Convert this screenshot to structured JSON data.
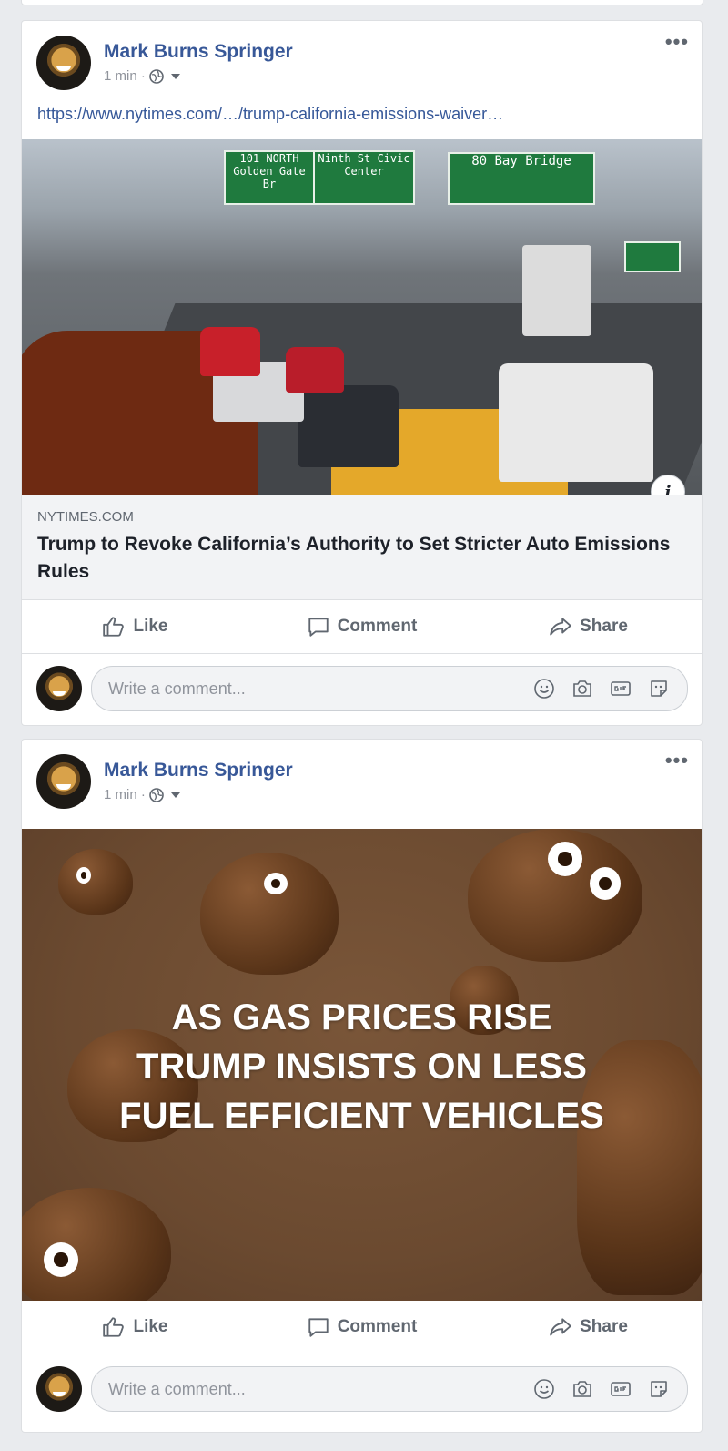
{
  "posts": [
    {
      "author": "Mark Burns Springer",
      "time": "1 min ·",
      "link_url": "https://www.nytimes.com/…/trump-california-emissions-waiver…",
      "link_domain": "NYTIMES.COM",
      "link_title": "Trump to Revoke California’s Authority to Set Stricter Auto Emissions Rules",
      "signs": [
        "101 NORTH Golden Gate Br",
        "Ninth St Civic Center",
        "80 Bay Bridge"
      ],
      "actions": {
        "like": "Like",
        "comment": "Comment",
        "share": "Share"
      },
      "comment_placeholder": "Write a comment..."
    },
    {
      "author": "Mark Burns Springer",
      "time": "1 min ·",
      "image_text": [
        "AS GAS PRICES RISE",
        "TRUMP INSISTS ON LESS",
        "FUEL EFFICIENT VEHICLES"
      ],
      "actions": {
        "like": "Like",
        "comment": "Comment",
        "share": "Share"
      },
      "comment_placeholder": "Write a comment..."
    }
  ],
  "icons": {
    "privacy": "globe-icon",
    "more": "more-options-icon",
    "like": "thumbs-up-icon",
    "comment": "speech-bubble-icon",
    "share": "share-arrow-icon",
    "info": "info-icon",
    "comment_tools": [
      "emoji-icon",
      "camera-icon",
      "gif-icon",
      "sticker-icon"
    ]
  },
  "colors": {
    "author": "#385898",
    "link": "#365899",
    "muted": "#606770",
    "background": "#e9ebee"
  }
}
